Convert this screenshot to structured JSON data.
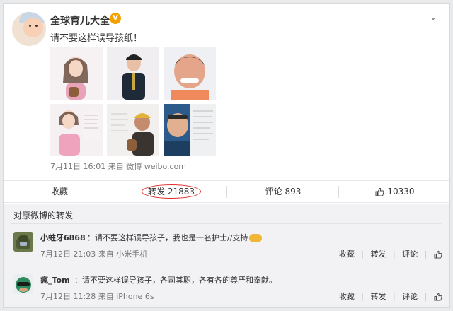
{
  "post": {
    "author": "全球育儿大全",
    "verified_badge": "V",
    "text": "请不要这样误导孩纸！",
    "time": "7月11日 16:01",
    "via": "来自 微博 weibo.com",
    "images": [
      "photo-1",
      "photo-2",
      "photo-3",
      "photo-4",
      "photo-5",
      "photo-6"
    ]
  },
  "actions": {
    "favorite": "收藏",
    "repost": "转发 21883",
    "comment": "评论 893",
    "like": "10330"
  },
  "forwards": {
    "header": "对原微博的转发",
    "items": [
      {
        "name": "小蛀牙6868",
        "sep": "：",
        "text": "请不要这样误导孩子，我也是一名护士//支持",
        "time": "7月12日 21:03",
        "via": "来自 小米手机",
        "fav": "收藏",
        "repost": "转发",
        "comment": "评论"
      },
      {
        "name": "瘋_Tom",
        "sep": "：",
        "text": "请不要这样误导孩子，各司其职，各有各的尊严和奉献。",
        "time": "7月12日 11:28",
        "via": "来自 iPhone 6s",
        "fav": "收藏",
        "repost": "转发",
        "comment": "评论"
      }
    ]
  },
  "colors": {
    "accent_circle": "#e02d2d",
    "verified": "#f4a100"
  },
  "icons": {
    "more": "chevron-down-icon",
    "like": "thumbs-up-icon"
  }
}
